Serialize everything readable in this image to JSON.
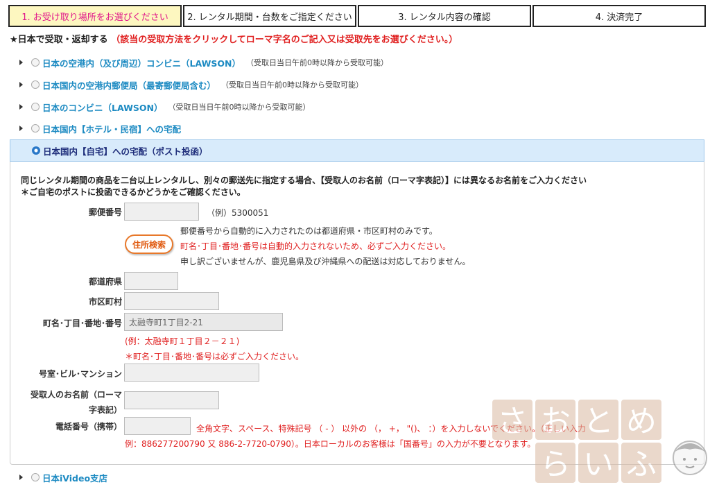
{
  "steps": [
    {
      "label": "1. お受け取り場所をお選びください",
      "active": true
    },
    {
      "label": "2. レンタル期間・台数をご指定ください",
      "active": false
    },
    {
      "label": "3. レンタル内容の確認",
      "active": false
    },
    {
      "label": "4. 決済完了",
      "active": false
    }
  ],
  "headline": {
    "title": "★日本で受取・返却する",
    "instruction": "（該当の受取方法をクリックしてローマ字名のご記入又は受取先をお選びください。）"
  },
  "options": [
    {
      "label": "日本の空港内（及び周辺）コンビニ（LAWSON）",
      "note": "（受取日当日午前0時以降から受取可能）"
    },
    {
      "label": "日本国内の空港内郵便局（最寄郵便局含む）",
      "note": "（受取日当日午前0時以降から受取可能）"
    },
    {
      "label": "日本のコンビニ（LAWSON）",
      "note": "（受取日当日午前0時以降から受取可能）"
    },
    {
      "label": "日本国内【ホテル・民宿】への宅配",
      "note": ""
    }
  ],
  "selected_option": {
    "label": "日本国内【自宅】への宅配（ポスト投函）"
  },
  "last_option": {
    "label": "日本iVideo支店"
  },
  "form": {
    "note1": "同じレンタル期間の商品を二台以上レンタルし、別々の郵送先に指定する場合、【受取人のお名前（ローマ字表記）】には異なるお名前をご入力ください",
    "note2": "＊ご自宅のポストに投函できるかどうかをご確認ください。",
    "postal_label": "郵便番号",
    "postal_value": "",
    "postal_example": "（例）5300051",
    "address_button": "住所検索",
    "info1": "郵便番号から自動的に入力されたのは都道府県・市区町村のみです。",
    "info2": "町名･丁目･番地･番号は自動的入力されないため、必ずご入力ください。",
    "info3": "申し訳ございませんが、鹿児島県及び沖縄県への配送は対応しておりません。",
    "pref_label": "都道府県",
    "city_label": "市区町村",
    "town_label": "町名･丁目･番地･番号",
    "town_placeholder": "太融寺町1丁目2-21",
    "town_example": "(例：太融寺町１丁目２－２１)",
    "town_required": "＊町名･丁目･番地･番号は必ずご入力ください。",
    "building_label": "号室･ビル･マンション",
    "recipient_label_1": "受取人のお名前（ローマ",
    "recipient_label_2": "字表記）",
    "phone_label": "電話番号（携帯）",
    "phone_rule": "全角文字、スペース、特殊記号 （ - ） 以外の （， +， \"()、 ：）を入力しないでください。（正しい入力",
    "phone_example": "例：886277200790 又 886-2-7720-0790）。日本ローカルのお客様は「国番号」の入力が不要となります。"
  },
  "watermark": {
    "line1": "さおとめ",
    "line2": "らいふ"
  },
  "colors": {
    "active_tab_bg": "#fdf7c0",
    "active_tab_text": "#e0168a",
    "link_blue": "#1c8ac2",
    "alert_red": "#e02020",
    "selected_bg": "#d8ebfb"
  }
}
